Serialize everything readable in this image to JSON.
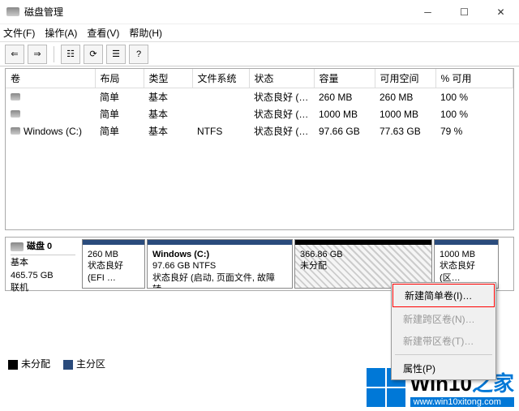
{
  "window": {
    "title": "磁盘管理"
  },
  "menu": {
    "file": "文件(F)",
    "action": "操作(A)",
    "view": "查看(V)",
    "help": "帮助(H)"
  },
  "table": {
    "headers": {
      "volume": "卷",
      "layout": "布局",
      "type": "类型",
      "fs": "文件系统",
      "status": "状态",
      "capacity": "容量",
      "free": "可用空间",
      "pct": "% 可用"
    },
    "rows": [
      {
        "volume": "",
        "layout": "简单",
        "type": "基本",
        "fs": "",
        "status": "状态良好 (…",
        "capacity": "260 MB",
        "free": "260 MB",
        "pct": "100 %"
      },
      {
        "volume": "",
        "layout": "简单",
        "type": "基本",
        "fs": "",
        "status": "状态良好 (…",
        "capacity": "1000 MB",
        "free": "1000 MB",
        "pct": "100 %"
      },
      {
        "volume": "Windows (C:)",
        "layout": "简单",
        "type": "基本",
        "fs": "NTFS",
        "status": "状态良好 (…",
        "capacity": "97.66 GB",
        "free": "77.63 GB",
        "pct": "79 %"
      }
    ]
  },
  "disk": {
    "name": "磁盘 0",
    "type": "基本",
    "size": "465.75 GB",
    "state": "联机",
    "partitions": [
      {
        "title": "",
        "line1": "260 MB",
        "line2": "状态良好 (EFI …"
      },
      {
        "title": "Windows  (C:)",
        "line1": "97.66 GB NTFS",
        "line2": "状态良好 (启动, 页面文件, 故障转…"
      },
      {
        "title": "",
        "line1": "366.86 GB",
        "line2": "未分配"
      },
      {
        "title": "",
        "line1": "1000 MB",
        "line2": "状态良好 (区…"
      }
    ]
  },
  "context": {
    "simple": "新建简单卷(I)…",
    "span": "新建跨区卷(N)…",
    "stripe": "新建带区卷(T)…",
    "prop": "属性(P)"
  },
  "legend": {
    "unalloc": "未分配",
    "primary": "主分区"
  },
  "watermark": {
    "brand_a": "Win10",
    "brand_b": "之家",
    "url": "www.win10xitong.com"
  }
}
